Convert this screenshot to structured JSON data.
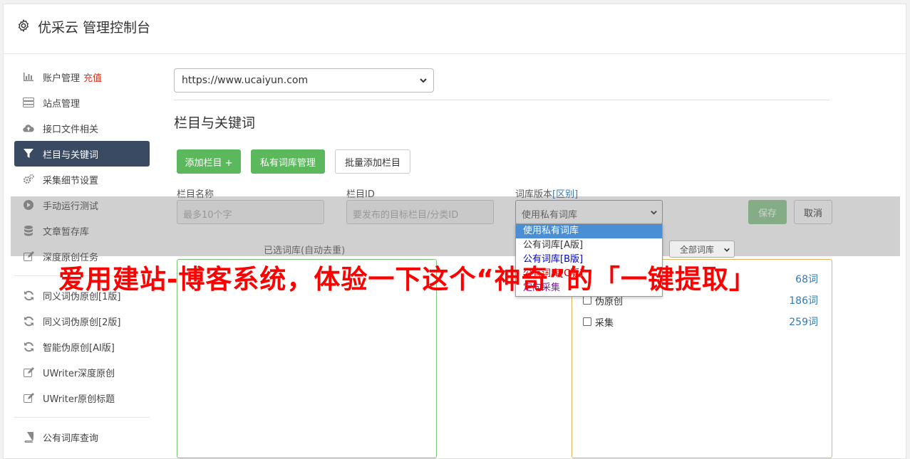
{
  "header": {
    "title": "优采云 管理控制台"
  },
  "sidebar": {
    "items": [
      {
        "label": "账户管理",
        "badge": "充值",
        "icon": "bar-chart-icon"
      },
      {
        "label": "站点管理",
        "icon": "server-icon"
      },
      {
        "label": "接口文件相关",
        "icon": "cloud-upload-icon"
      },
      {
        "label": "栏目与关键词",
        "icon": "filter-icon",
        "active": true
      },
      {
        "label": "采集细节设置",
        "icon": "cogs-icon"
      },
      {
        "label": "手动运行测试",
        "icon": "play-circle-icon"
      },
      {
        "label": "文章暂存库",
        "icon": "database-icon"
      },
      {
        "label": "深度原创任务",
        "icon": "edit-icon"
      }
    ],
    "items2": [
      {
        "label": "同义词伪原创[1版]",
        "icon": "refresh-icon"
      },
      {
        "label": "同义词伪原创[2版]",
        "icon": "refresh-icon"
      },
      {
        "label": "智能伪原创[AI版]",
        "icon": "refresh-icon"
      },
      {
        "label": "UWriter深度原创",
        "icon": "edit-icon"
      },
      {
        "label": "UWriter原创标题",
        "icon": "edit-icon"
      }
    ],
    "items3": [
      {
        "label": "公有词库查询",
        "icon": "book-icon"
      }
    ]
  },
  "main": {
    "site_select": "https://www.ucaiyun.com",
    "section_title": "栏目与关键词",
    "buttons": {
      "add_column": "添加栏目 +",
      "private_lib": "私有词库管理",
      "batch_add": "批量添加栏目",
      "save": "保存",
      "cancel": "取消"
    },
    "form": {
      "name_label": "栏目名称",
      "name_placeholder": "最多10个字",
      "id_label": "栏目ID",
      "id_placeholder": "要发布的目标栏目/分类ID",
      "version_label": "词库版本",
      "version_link": "[区别]",
      "version_value": "使用私有词库"
    },
    "dropdown_options": [
      {
        "label": "使用私有词库",
        "color": "#ffffff"
      },
      {
        "label": "公有词库[A版]",
        "color": "#333333"
      },
      {
        "label": "公有词库[B版]",
        "color": "#0000cc"
      },
      {
        "label": "公有词库[C版]",
        "color": "#cc0000"
      },
      {
        "label": "定向采集",
        "color": "#7a1fa2"
      }
    ],
    "selected_lib_label": "已选词库(自动去重)",
    "filter_select": "全部词库",
    "libraries": [
      {
        "name": "",
        "count": "68词"
      },
      {
        "name": "伪原创",
        "count": "186词"
      },
      {
        "name": "采集",
        "count": "259词"
      }
    ]
  },
  "banner_text": "爱用建站-博客系统，体验一下这个“神奇”的「一键提取」"
}
